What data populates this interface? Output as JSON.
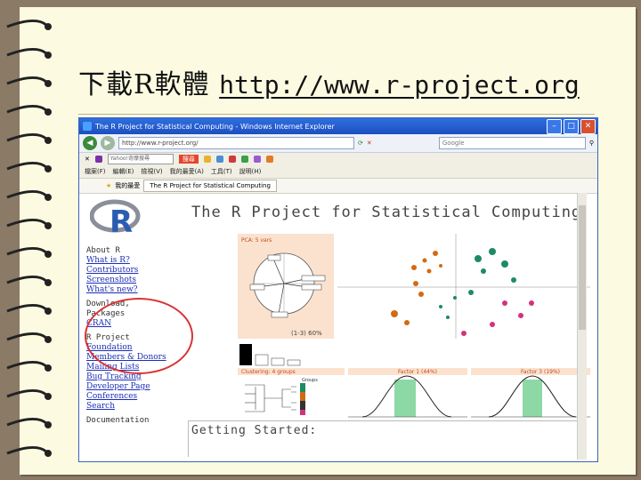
{
  "slide": {
    "title_cjk": "下載R軟體",
    "title_url": "http://www.r-project.org"
  },
  "browser": {
    "window_title": "The R Project for Statistical Computing - Windows Internet Explorer",
    "address": "http://www.r-project.org/",
    "search_placeholder": "Google",
    "yahoo_search": "Yahoo!奇摩搜尋",
    "yahoo_btn": "搜尋",
    "menu": [
      "檔案(F)",
      "編輯(E)",
      "檢視(V)",
      "我的最愛(A)",
      "工具(T)",
      "說明(H)"
    ],
    "fav_label": "我的最愛",
    "tab_label": "The R Project for Statistical Computing"
  },
  "page": {
    "main_title": "The R Project for Statistical Computing",
    "getting_started": "Getting Started:",
    "nav": {
      "about_header": "About R",
      "about_links": [
        "What is R?",
        "Contributors",
        "Screenshots",
        "What's new?"
      ],
      "download_header": "Download, Packages",
      "download_links": [
        "CRAN"
      ],
      "project_header": "R Project",
      "project_links": [
        "Foundation",
        "Members & Donors",
        "Mailing Lists",
        "Bug Tracking",
        "Developer Page",
        "Conferences",
        "Search"
      ],
      "doc_header": "Documentation"
    },
    "figure": {
      "pca_title": "PCA: 5 vars",
      "pca_subtitle": "(1-3) 60%",
      "clustering": "Clustering: 4 groups",
      "factor1": "Factor 1 (44%)",
      "factor3": "Factor 3 (19%)",
      "groups_label": "Groups"
    }
  },
  "colors": {
    "accent_red": "#d83434",
    "link_blue": "#1b2fb4",
    "title_blue": "#2f6fe0"
  }
}
